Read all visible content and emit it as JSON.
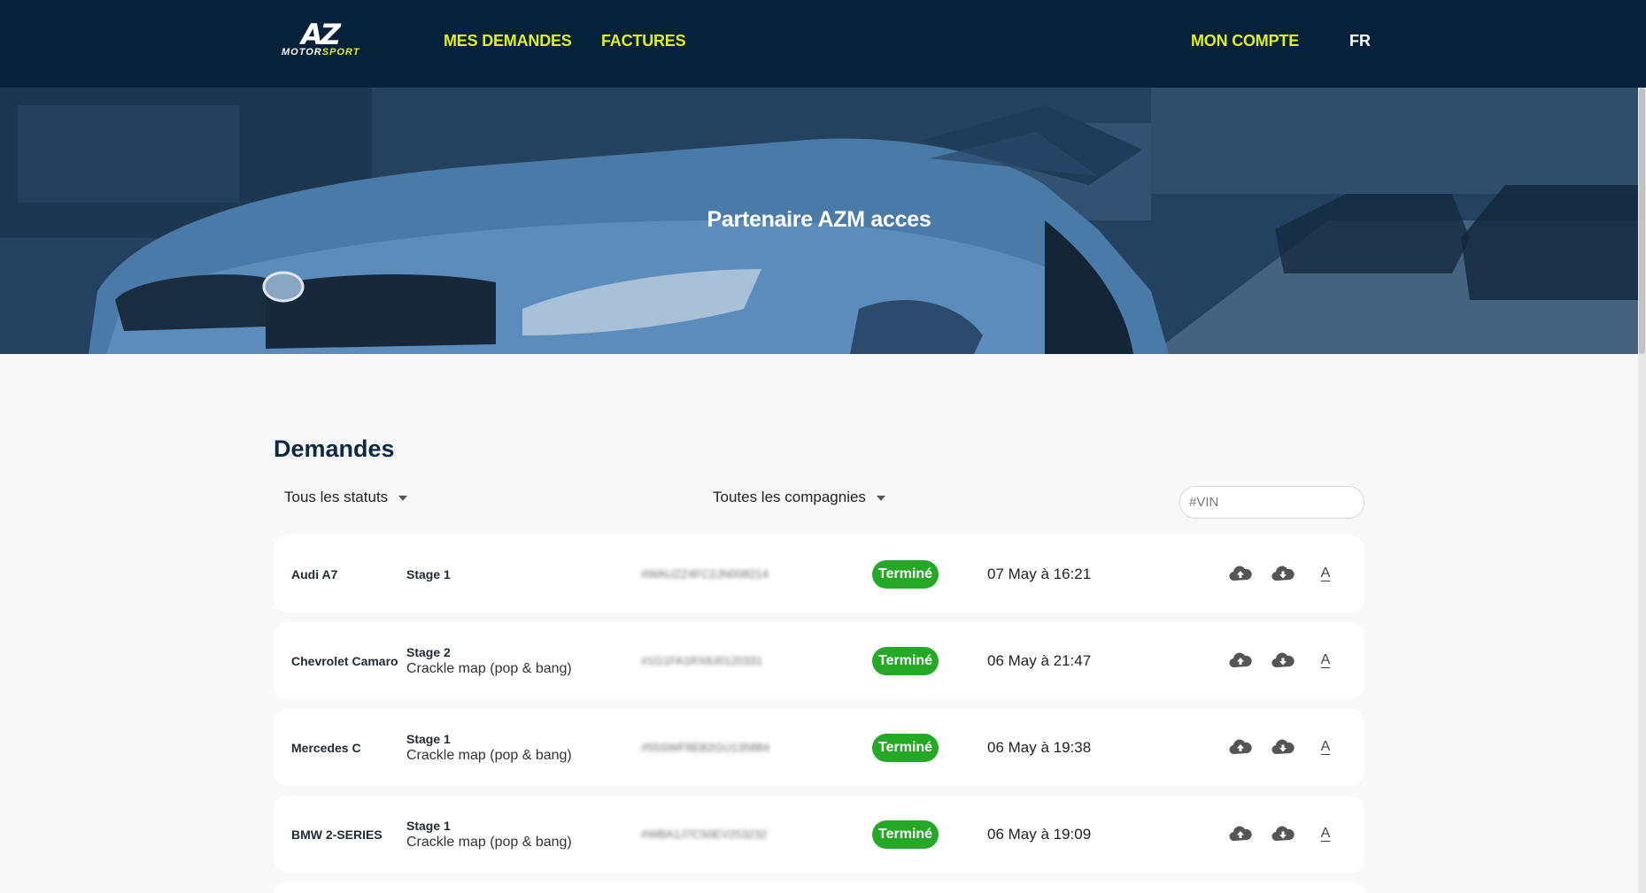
{
  "header": {
    "logo_primary": "AZ",
    "logo_secondary_a": "MOTOR",
    "logo_secondary_b": "SPORT",
    "nav": {
      "requests": "MES DEMANDES",
      "invoices": "FACTURES",
      "account": "MON COMPTE",
      "language": "FR"
    }
  },
  "hero": {
    "title": "Partenaire AZM acces"
  },
  "requests": {
    "title": "Demandes",
    "filters": {
      "status": "Tous les statuts",
      "company": "Toutes les compagnies",
      "vin_placeholder": "#VIN"
    },
    "rows": [
      {
        "car": "Audi A7",
        "stage": "Stage 1",
        "option": "",
        "vin": "#WAUZZ4FC2JN008214",
        "status": "Terminé",
        "date": "07 May à 16:21"
      },
      {
        "car": "Chevrolet Camaro",
        "stage": "Stage 2",
        "option": "Crackle map (pop & bang)",
        "vin": "#1G1FA1RX8J0120331",
        "status": "Terminé",
        "date": "06 May à 21:47"
      },
      {
        "car": "Mercedes C",
        "stage": "Stage 1",
        "option": "Crackle map (pop & bang)",
        "vin": "#55SWF8EB2GU135884",
        "status": "Terminé",
        "date": "06 May à 19:38"
      },
      {
        "car": "BMW 2-SERIES",
        "stage": "Stage 1",
        "option": "Crackle map (pop & bang)",
        "vin": "#WBA1J7C50EV253232",
        "status": "Terminé",
        "date": "06 May à 19:09"
      }
    ],
    "actions": {
      "upload_icon": "cloud-upload-icon",
      "download_icon": "cloud-download-icon",
      "text_icon_label": "A"
    }
  },
  "colors": {
    "header_bg": "#06213a",
    "accent": "#e1ef1c",
    "status_done": "#25a825",
    "title": "#0f2a40"
  }
}
